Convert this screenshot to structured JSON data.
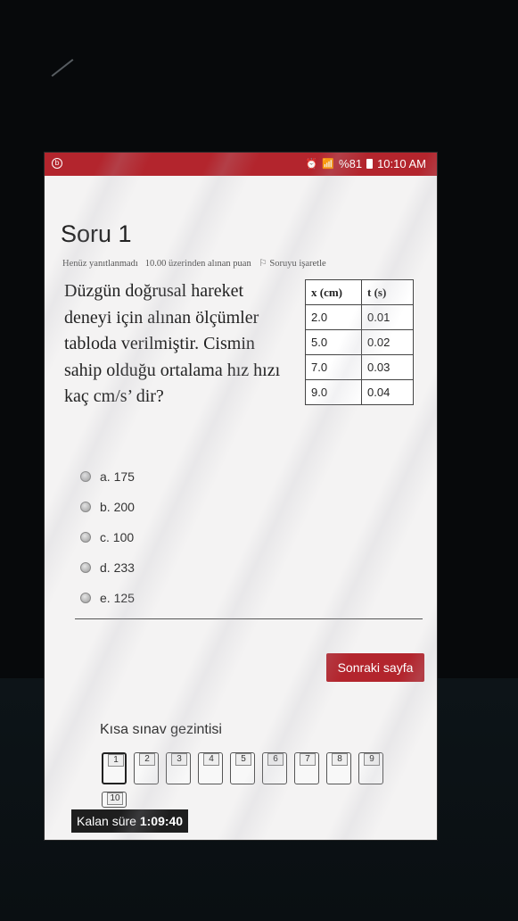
{
  "status_bar": {
    "notification_icon": "circle-b-icon",
    "alarm_icon": "alarm-icon",
    "signal_icon": "wifi-signal-icon",
    "battery_text": "%81",
    "time": "10:10 AM",
    "color": "#b3252d"
  },
  "quiz": {
    "title": "Soru 1",
    "status": "Henüz yanıtlanmadı",
    "points": "10.00 üzerinden alınan puan",
    "flag_label": "Soruyu işaretle",
    "question_text": "Düzgün doğrusal hareket deneyi için alınan ölçümler tabloda verilmiştir. Cismin sahip olduğu ortalama hız hızı kaç cm/s’ dir?",
    "table": {
      "headers": [
        "x (cm)",
        "t (s)"
      ],
      "rows": [
        [
          "2.0",
          "0.01"
        ],
        [
          "5.0",
          "0.02"
        ],
        [
          "7.0",
          "0.03"
        ],
        [
          "9.0",
          "0.04"
        ]
      ]
    },
    "answers": [
      "a. 175",
      "b. 200",
      "c. 100",
      "d. 233",
      "e. 125"
    ],
    "next_button": "Sonraki sayfa",
    "accent_color": "#b3252d"
  },
  "navigation": {
    "title": "Kısa sınav gezintisi",
    "buttons": [
      "1",
      "2",
      "3",
      "4",
      "5",
      "6",
      "7",
      "8",
      "9",
      "10"
    ],
    "current": "1"
  },
  "timer": {
    "label": "Kalan süre",
    "value": "1:09:40"
  }
}
